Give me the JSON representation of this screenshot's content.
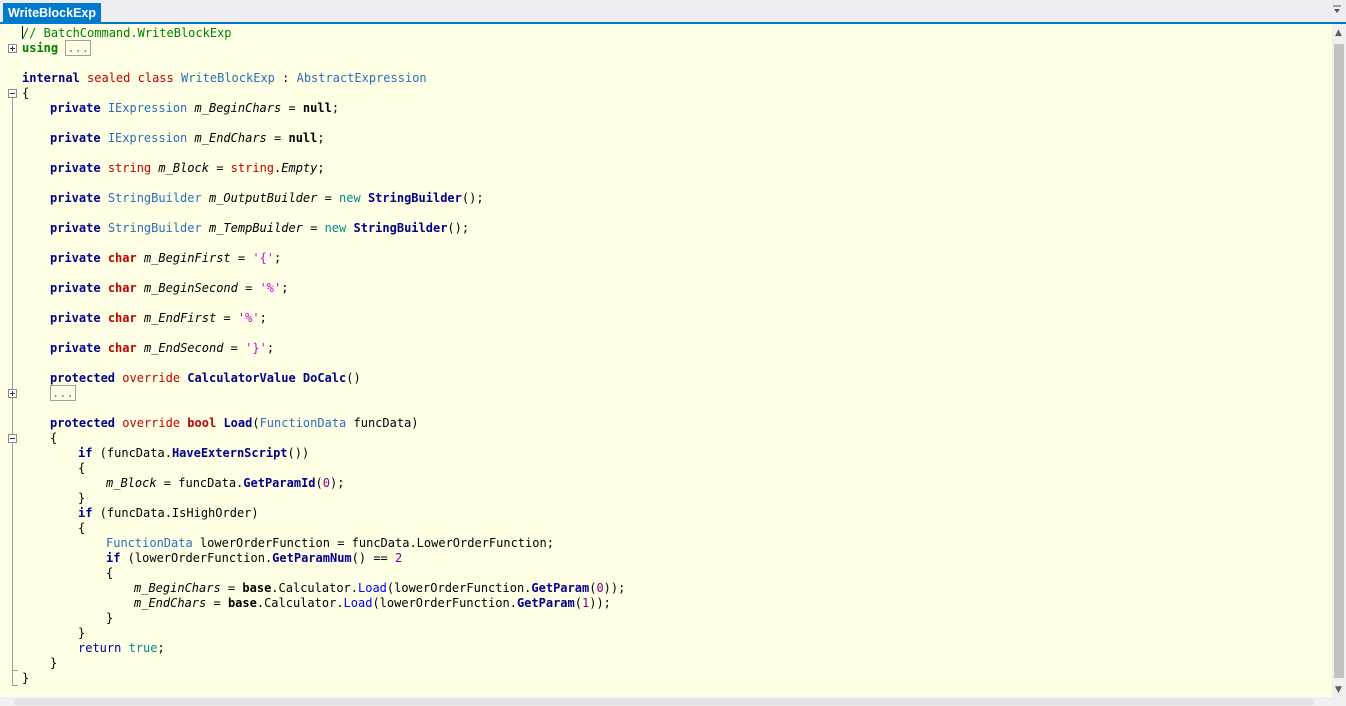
{
  "tab": {
    "title": "WriteBlockExp"
  },
  "icons": {
    "dropdown": "chevron-down-icon",
    "fold_expand": "plus-box-icon",
    "fold_collapse": "minus-box-icon"
  },
  "code": {
    "comment": "// BatchCommand.WriteBlockExp",
    "using_kw": "using",
    "ellipsis": "...",
    "class_decl": {
      "internal": "internal",
      "sealed": "sealed",
      "class": "class",
      "name": "WriteBlockExp",
      "colon": " : ",
      "base": "AbstractExpression"
    },
    "lines": {
      "open_brace": "{",
      "close_brace": "}",
      "f1": {
        "mod": "private",
        "type": "IExpression",
        "name": "m_BeginChars",
        "rest1": " = ",
        "val": "null",
        "rest2": ";"
      },
      "f2": {
        "mod": "private",
        "type": "IExpression",
        "name": "m_EndChars",
        "rest1": " = ",
        "val": "null",
        "rest2": ";"
      },
      "f3": {
        "mod": "private",
        "type": "string",
        "name": "m_Block",
        "rest1": " = ",
        "val1": "string",
        "dot": ".",
        "val2": "Empty",
        "rest2": ";"
      },
      "f4": {
        "mod": "private",
        "type": "StringBuilder",
        "name": "m_OutputBuilder",
        "rest1": " = ",
        "nw": "new",
        "ctor": "StringBuilder",
        "rest2": "();"
      },
      "f5": {
        "mod": "private",
        "type": "StringBuilder",
        "name": "m_TempBuilder",
        "rest1": " = ",
        "nw": "new",
        "ctor": "StringBuilder",
        "rest2": "();"
      },
      "f6": {
        "mod": "private",
        "type": "char",
        "name": "m_BeginFirst",
        "rest1": " = ",
        "val": "'{'",
        "rest2": ";"
      },
      "f7": {
        "mod": "private",
        "type": "char",
        "name": "m_BeginSecond",
        "rest1": " = ",
        "val": "'%'",
        "rest2": ";"
      },
      "f8": {
        "mod": "private",
        "type": "char",
        "name": "m_EndFirst",
        "rest1": " = ",
        "val": "'%'",
        "rest2": ";"
      },
      "f9": {
        "mod": "private",
        "type": "char",
        "name": "m_EndSecond",
        "rest1": " = ",
        "val": "'}'",
        "rest2": ";"
      },
      "m1": {
        "mod": "protected",
        "ovr": "override",
        "type": "CalculatorValue",
        "name": "DoCalc",
        "rest": "()"
      },
      "m2": {
        "mod": "protected",
        "ovr": "override",
        "type": "bool",
        "name": "Load",
        "p1": "(",
        "ptype": "FunctionData",
        "pname": " funcData)"
      },
      "if1": {
        "kw": "if",
        "a": " (funcData.",
        "meth": "HaveExternScript",
        "b": "())"
      },
      "assign1": {
        "lhs": "m_Block",
        "a": " = funcData.",
        "meth": "GetParamId",
        "b": "(",
        "num": "0",
        "c": ");"
      },
      "if2": {
        "kw": "if",
        "a": " (funcData.IsHighOrder)"
      },
      "decl": {
        "type": "FunctionData",
        "a": " lowerOrderFunction = funcData.LowerOrderFunction;"
      },
      "if3": {
        "kw": "if",
        "a": " (lowerOrderFunction.",
        "meth": "GetParamNum",
        "b": "() == ",
        "num": "2"
      },
      "assign2": {
        "lhs": "m_BeginChars",
        "a": " = ",
        "base": "base",
        "b": ".Calculator.",
        "meth": "Load",
        "c": "(lowerOrderFunction.",
        "meth2": "GetParam",
        "d": "(",
        "num": "0",
        "e": "));"
      },
      "assign3": {
        "lhs": "m_EndChars",
        "a": " = ",
        "base": "base",
        "b": ".Calculator.",
        "meth": "Load",
        "c": "(lowerOrderFunction.",
        "meth2": "GetParam",
        "d": "(",
        "num": "1",
        "e": "));"
      },
      "ret": {
        "kw": "return",
        "sp": " ",
        "val": "true",
        "semi": ";"
      }
    }
  }
}
